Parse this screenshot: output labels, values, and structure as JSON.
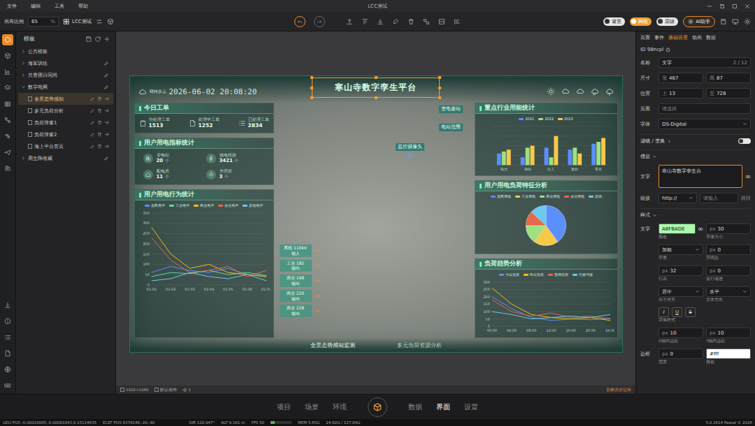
{
  "menubar": {
    "menus": [
      "文件",
      "编辑",
      "工具",
      "帮助"
    ],
    "title": "LCC测试"
  },
  "toolbar": {
    "zoom_label": "画布比例",
    "zoom_value": "65",
    "zoom_unit": "%",
    "project": "LCC测试",
    "toggles": [
      {
        "label": "背景",
        "on": false
      },
      {
        "label": "网格",
        "on": true
      },
      {
        "label": "层级",
        "on": false
      }
    ],
    "ai_button": "AI助手"
  },
  "rail": {
    "top": [
      {
        "selected": true
      },
      {
        "selected": false
      },
      {
        "selected": false
      },
      {
        "selected": false
      },
      {
        "selected": false
      },
      {
        "selected": false
      },
      {
        "selected": false
      },
      {
        "selected": false
      },
      {
        "selected": false
      }
    ],
    "bottom": [
      {
        "selected": false
      },
      {
        "selected": false
      },
      {
        "selected": false
      },
      {
        "selected": false
      },
      {
        "selected": false
      },
      {
        "selected": false
      }
    ]
  },
  "templates": {
    "title": "模板",
    "groups": [
      {
        "label": "公共模板",
        "expanded": false,
        "editable": false,
        "items": []
      },
      {
        "label": "海军训练",
        "expanded": false,
        "editable": true,
        "items": []
      },
      {
        "label": "共青团日同间",
        "expanded": false,
        "editable": true,
        "items": []
      },
      {
        "label": "数字电网",
        "expanded": true,
        "editable": true,
        "items": [
          {
            "label": "全景态势感知",
            "selected": true
          },
          {
            "label": "多元负荷分析",
            "selected": false
          },
          {
            "label": "负荷弹窗1",
            "selected": false
          },
          {
            "label": "负荷弹窗2",
            "selected": false
          },
          {
            "label": "海上平台首页",
            "selected": false
          }
        ]
      },
      {
        "label": "周生阵收藏",
        "expanded": false,
        "editable": true,
        "items": []
      }
    ]
  },
  "canvas": {
    "resolution": "1920×1080",
    "page": "默认画布",
    "layers": "1",
    "history": "切换历史记录"
  },
  "dashboard": {
    "weather": "晴转多云",
    "datetime": "2026-06-02 20:08:20",
    "title": "寒山寺数字孪生平台",
    "work_orders": {
      "title": "今日工单",
      "items": [
        {
          "label": "待处理工单",
          "value": "1513"
        },
        {
          "label": "处理中工单",
          "value": "1252"
        },
        {
          "label": "已处理工单",
          "value": "2834"
        }
      ]
    },
    "indicators": {
      "title": "用户用电指标统计",
      "items": [
        {
          "label": "变电站",
          "value": "20",
          "unit": "个"
        },
        {
          "label": "输电线路",
          "value": "3421",
          "unit": "个"
        },
        {
          "label": "配电房",
          "value": "11",
          "unit": "个"
        },
        {
          "label": "开闭所",
          "value": "3",
          "unit": "个"
        }
      ]
    },
    "behavior": {
      "title": "用户用电行为统计",
      "y_max": 350,
      "y_ticks": [
        "350",
        "300",
        "250",
        "200",
        "150",
        "100",
        "50",
        "0"
      ],
      "x_labels": [
        "01-01",
        "01-02",
        "01-03",
        "01-04",
        "01-05",
        "01-06",
        "01-07"
      ],
      "series": [
        {
          "name": "居民用户",
          "color": "#5b8ff9",
          "values": [
            60,
            90,
            70,
            60,
            80,
            50,
            40
          ]
        },
        {
          "name": "工业用户",
          "color": "#5ad8a6",
          "values": [
            40,
            60,
            55,
            70,
            50,
            60,
            45
          ]
        },
        {
          "name": "商业用户",
          "color": "#f6bd16",
          "values": [
            280,
            150,
            80,
            100,
            60,
            50,
            40
          ]
        },
        {
          "name": "农业用户",
          "color": "#e8684a",
          "values": [
            230,
            120,
            60,
            70,
            90,
            40,
            70
          ]
        },
        {
          "name": "其他用户",
          "color": "#6dc8ec",
          "values": [
            20,
            30,
            60,
            40,
            30,
            50,
            20
          ]
        }
      ]
    },
    "markers": [
      {
        "label": "变电基站",
        "kind": "station"
      },
      {
        "label": "电站范围",
        "kind": "station"
      },
      {
        "label": "监控摄像头",
        "kind": "camera"
      }
    ],
    "controls": [
      {
        "name": "离线 110kV",
        "action": "输入"
      },
      {
        "name": "工业 182",
        "action": "输出"
      },
      {
        "name": "商业 198",
        "action": "输出"
      },
      {
        "name": "商业 220",
        "action": "输出"
      },
      {
        "name": "商业 228",
        "action": "输出"
      }
    ],
    "industry": {
      "title": "重点行业用能统计",
      "y_max": 100,
      "categories": [
        "电力",
        "钢铁",
        "化工",
        "建材",
        "有色"
      ],
      "series": [
        {
          "name": "2021",
          "color": "#5b8ff9",
          "values": [
            30,
            20,
            45,
            40,
            55
          ]
        },
        {
          "name": "2022",
          "color": "#9fe080",
          "values": [
            35,
            45,
            20,
            45,
            60
          ]
        },
        {
          "name": "2023",
          "color": "#f6c94a",
          "values": [
            40,
            50,
            75,
            30,
            70
          ]
        }
      ]
    },
    "load_feature": {
      "title": "用户用电负荷特征分析",
      "slices": [
        {
          "name": "居民用电",
          "color": "#5b8ff9",
          "value": 40
        },
        {
          "name": "工业用电",
          "color": "#f6c94a",
          "value": 20
        },
        {
          "name": "商业用电",
          "color": "#9fe080",
          "value": 15
        },
        {
          "name": "农业用电",
          "color": "#e8684a",
          "value": 12
        },
        {
          "name": "其他",
          "color": "#6dc8ec",
          "value": 13
        }
      ]
    },
    "trend": {
      "title": "负荷趋势分析",
      "y_max": 300,
      "y_ticks": [
        "300",
        "250",
        "200",
        "150",
        "100",
        "50",
        "0"
      ],
      "x_labels": [
        "00:00",
        "04:00",
        "08:00",
        "12:00",
        "16:00",
        "20:00",
        "24:00"
      ],
      "series": [
        {
          "name": "今日负荷",
          "color": "#5b8ff9",
          "values": [
            200,
            120,
            60,
            40,
            50,
            45,
            55
          ]
        },
        {
          "name": "昨日负荷",
          "color": "#f6bd16",
          "values": [
            260,
            150,
            80,
            60,
            50,
            60,
            40
          ]
        },
        {
          "name": "预测负荷",
          "color": "#e8684a",
          "values": [
            180,
            100,
            70,
            90,
            60,
            70,
            50
          ]
        },
        {
          "name": "历史均值",
          "color": "#6dc8ec",
          "values": [
            100,
            80,
            50,
            60,
            70,
            60,
            80
          ]
        }
      ]
    },
    "tabs": [
      {
        "label": "全景态势感知监测",
        "selected": true
      },
      {
        "label": "多元负荷资源分析",
        "selected": false
      }
    ]
  },
  "inspector": {
    "tabs": [
      {
        "label": "页面",
        "selected": false
      },
      {
        "label": "事件",
        "selected": false
      },
      {
        "label": "基础设置",
        "selected": true
      },
      {
        "label": "动画",
        "selected": false
      },
      {
        "label": "数据",
        "selected": false
      }
    ],
    "id": "ID 98ncpl",
    "name_label": "名称",
    "name_value": "文字",
    "name_count": "2 / 12",
    "size_label": "尺寸",
    "width": {
      "prefix": "宽",
      "value": "467"
    },
    "height": {
      "prefix": "高",
      "value": "87"
    },
    "pos_label": "位置",
    "top": {
      "prefix": "上",
      "value": "13"
    },
    "left": {
      "prefix": "左",
      "value": "728"
    },
    "page_label": "页面",
    "page_value": "请选择",
    "font_label": "字体",
    "font_value": "DS-Digital",
    "filter_section": "滤镜 / 变换",
    "filter_on": false,
    "info_section": "信息",
    "text_label": "文字",
    "text_value": "寒山寺数字孪生台",
    "text_link": "∞",
    "link_label": "链接",
    "link_protocol": "http://",
    "link_placeholder": "请输入",
    "link_action": "跳转",
    "style_section": "样式",
    "style_rows": [
      {
        "label": "文字",
        "fields": [
          {
            "kind": "color",
            "value": "A8FBADE",
            "color": "#a8fbad",
            "suffix": "∞",
            "caption": "颜色"
          },
          {
            "kind": "input",
            "prefix": "px",
            "value": "30",
            "caption": "字体大小"
          }
        ]
      },
      {
        "fields": [
          {
            "kind": "select",
            "value": "加粗",
            "caption": "字重"
          },
          {
            "kind": "input",
            "prefix": "px",
            "value": "0",
            "caption": "字间距"
          }
        ]
      },
      {
        "fields": [
          {
            "kind": "input",
            "prefix": "px",
            "value": "32",
            "caption": "行高"
          },
          {
            "kind": "input",
            "prefix": "px",
            "value": "0",
            "caption": "首行缩进"
          }
        ]
      },
      {
        "fields": [
          {
            "kind": "select",
            "value": "居中",
            "caption": "水平对齐"
          },
          {
            "kind": "select",
            "value": "水平",
            "caption": "文本方向"
          }
        ]
      },
      {
        "fields": [
          {
            "kind": "buttons",
            "buttons": [
              {
                "label": "I",
                "style": "italic"
              },
              {
                "label": "U",
                "style": "underline"
              },
              {
                "label": "S",
                "style": "strike"
              }
            ],
            "caption": "字体样式"
          }
        ]
      },
      {
        "fields": [
          {
            "kind": "input",
            "prefix": "px",
            "value": "10",
            "caption": "X轴内边距"
          },
          {
            "kind": "input",
            "prefix": "px",
            "value": "10",
            "caption": "Y轴内边距"
          }
        ]
      },
      {
        "label": "边框",
        "fields": [
          {
            "kind": "input",
            "prefix": "px",
            "value": "0",
            "caption": "宽度"
          },
          {
            "kind": "color",
            "value": "#fff",
            "color": "#ffffff",
            "caption": "颜色"
          }
        ]
      }
    ]
  },
  "bottom_nav": {
    "left": [
      {
        "label": "项目",
        "selected": false
      },
      {
        "label": "场景",
        "selected": false
      },
      {
        "label": "环境",
        "selected": false
      }
    ],
    "right": [
      {
        "label": "数据",
        "selected": false
      },
      {
        "label": "界面",
        "selected": true
      },
      {
        "label": "设置",
        "selected": false
      }
    ]
  },
  "status_bar": {
    "geo": "GEO POS -0.00018085,-0.00081843,9.15114635",
    "ecef": "ECEF POS 6378146,-20,-90",
    "dir": "DIR 120.947°",
    "alt": "ALT 9.161 m",
    "fps": "FPS 50",
    "meter_level": 0.2,
    "mem": "MEM 5.65G",
    "mem_total": "24.62G / 127.89G",
    "version": "5.0.1614 Pascal © 2026"
  }
}
